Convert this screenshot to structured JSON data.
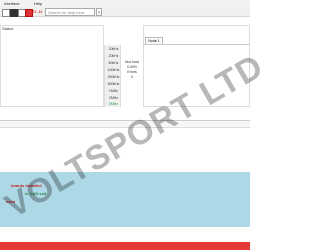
{
  "menubar": {
    "items": [
      "Interface",
      "Help"
    ]
  },
  "toolbar": {
    "text_a": "J2",
    "text_b": "J2",
    "search_placeholder": "Search for help here.",
    "help_label": "?"
  },
  "left_panel": {
    "title": "Status"
  },
  "speeds": [
    {
      "label": "10kHz",
      "active": false
    },
    {
      "label": "20kHz",
      "active": false
    },
    {
      "label": "50kHz",
      "active": false
    },
    {
      "label": "100kHz",
      "active": false
    },
    {
      "label": "200kHz",
      "active": false
    },
    {
      "label": "500kHz",
      "active": false
    },
    {
      "label": "1MHz",
      "active": false
    },
    {
      "label": "2MHz",
      "active": false
    },
    {
      "label": "3MHz",
      "active": true
    }
  ],
  "status_col": {
    "line1": "Bus load",
    "line2": "0.00%",
    "line3": "Errors",
    "line4": "0"
  },
  "right_panel": {
    "tab_label": "Node 1"
  },
  "log": {
    "line1": "boards installed",
    "line2": "is CAN sett",
    "line3": "ssed"
  },
  "watermark": "VOLTSPORT LTD",
  "colors": {
    "log_bg": "#add8e6",
    "status_strip": "#e53935",
    "active_speed": "#1e9e3c"
  }
}
